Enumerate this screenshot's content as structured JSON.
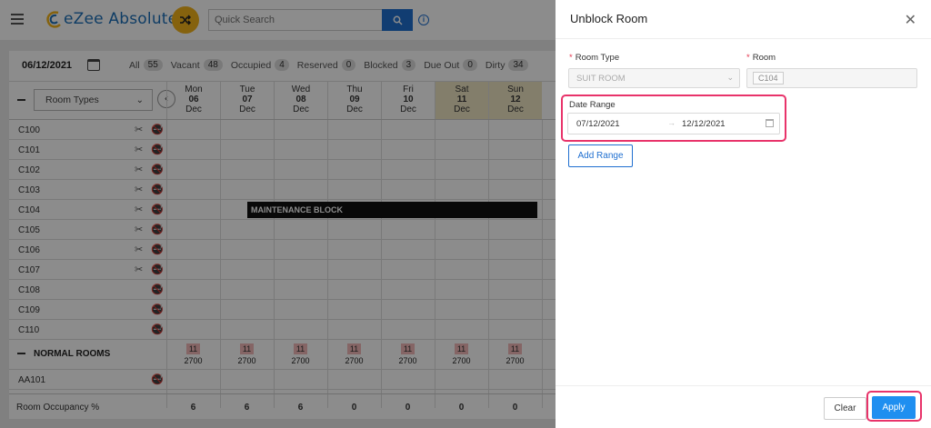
{
  "header": {
    "app_name": "eZee Absolute",
    "search_placeholder": "Quick Search"
  },
  "toolbar": {
    "date": "06/12/2021",
    "filters": [
      {
        "label": "All",
        "count": "55"
      },
      {
        "label": "Vacant",
        "count": "48"
      },
      {
        "label": "Occupied",
        "count": "4"
      },
      {
        "label": "Reserved",
        "count": "0"
      },
      {
        "label": "Blocked",
        "count": "3"
      },
      {
        "label": "Due Out",
        "count": "0"
      },
      {
        "label": "Dirty",
        "count": "34"
      }
    ]
  },
  "grid": {
    "room_types_label": "Room Types",
    "days": [
      {
        "dow": "Mon",
        "date": "06",
        "mon": "Dec",
        "weekend": false
      },
      {
        "dow": "Tue",
        "date": "07",
        "mon": "Dec",
        "weekend": false
      },
      {
        "dow": "Wed",
        "date": "08",
        "mon": "Dec",
        "weekend": false
      },
      {
        "dow": "Thu",
        "date": "09",
        "mon": "Dec",
        "weekend": false
      },
      {
        "dow": "Fri",
        "date": "10",
        "mon": "Dec",
        "weekend": false
      },
      {
        "dow": "Sat",
        "date": "11",
        "mon": "Dec",
        "weekend": true
      },
      {
        "dow": "Sun",
        "date": "12",
        "mon": "Dec",
        "weekend": true
      }
    ],
    "rooms": [
      {
        "name": "C100",
        "icons": 2
      },
      {
        "name": "C101",
        "icons": 2
      },
      {
        "name": "C102",
        "icons": 2
      },
      {
        "name": "C103",
        "icons": 2
      },
      {
        "name": "C104",
        "icons": 2
      },
      {
        "name": "C105",
        "icons": 2
      },
      {
        "name": "C106",
        "icons": 2
      },
      {
        "name": "C107",
        "icons": 2
      },
      {
        "name": "C108",
        "icons": 1
      },
      {
        "name": "C109",
        "icons": 1
      },
      {
        "name": "C110",
        "icons": 1
      }
    ],
    "maintenance_block_label": "MAINTENANCE BLOCK",
    "section_label": "NORMAL ROOMS",
    "section_counts": [
      "11",
      "11",
      "11",
      "11",
      "11",
      "11",
      "11"
    ],
    "section_prices": [
      "2700",
      "2700",
      "2700",
      "2700",
      "2700",
      "2700",
      "2700"
    ],
    "extra_room": "AA101",
    "occupancy_label": "Room Occupancy %",
    "occupancy_values": [
      "6",
      "6",
      "6",
      "0",
      "0",
      "0",
      "0"
    ]
  },
  "panel": {
    "title": "Unblock Room",
    "room_type_label": "Room Type",
    "room_type_value": "SUIT ROOM",
    "room_label": "Room",
    "room_value": "C104",
    "date_range_label": "Date Range",
    "date_from": "07/12/2021",
    "date_to": "12/12/2021",
    "add_range_label": "Add Range",
    "clear_label": "Clear",
    "apply_label": "Apply"
  },
  "colors": {
    "accent": "#1f6fd0",
    "apply": "#1f8ff0",
    "highlight": "#e8336a",
    "weekend": "#efe6c3"
  }
}
